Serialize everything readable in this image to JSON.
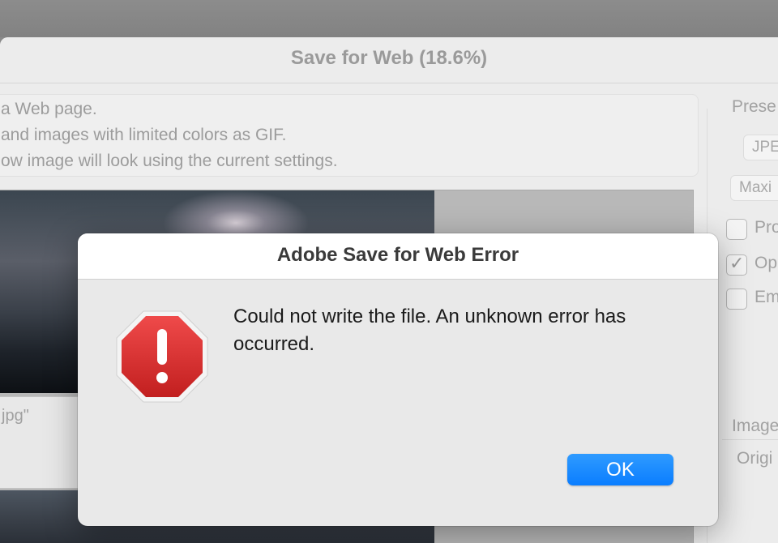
{
  "background_window": {
    "title": "Save for Web (18.6%)",
    "info_lines": [
      "a Web page.",
      "and images with limited colors as GIF.",
      "ow image will look using the current settings."
    ],
    "filename_fragment": "jpg\"",
    "right_panel": {
      "preset_label": "Prese",
      "format_select": "JPE",
      "quality_select": "Maxi",
      "checkboxes": [
        {
          "label": "Pro",
          "checked": false
        },
        {
          "label": "Op",
          "checked": true
        },
        {
          "label": "Em",
          "checked": false
        }
      ],
      "image_size_label": "Image",
      "original_label": "Origi"
    }
  },
  "dialog": {
    "title": "Adobe Save for Web Error",
    "message": "Could not write the file. An unknown error has occurred.",
    "icon": "stop-error-icon",
    "ok_label": "OK"
  },
  "colors": {
    "accent": "#0a7dff",
    "stop_red": "#d42a2a"
  }
}
